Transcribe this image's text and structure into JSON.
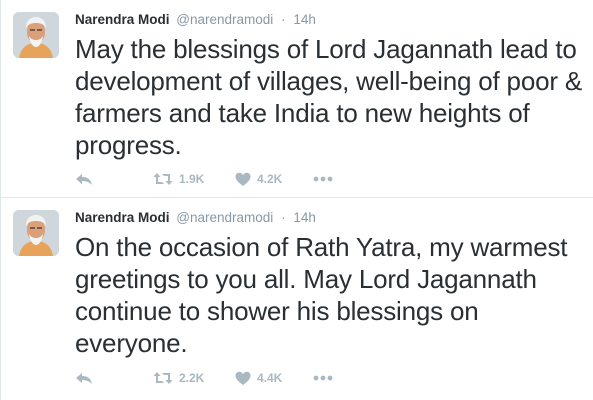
{
  "tweets": [
    {
      "author_name": "Narendra Modi",
      "author_handle": "@narendramodi",
      "separator": "·",
      "time": "14h",
      "text": "May the blessings of Lord Jagannath lead to development of villages, well-being of poor & farmers and take India to new heights of progress.",
      "retweets": "1.9K",
      "likes": "4.2K"
    },
    {
      "author_name": "Narendra Modi",
      "author_handle": "@narendramodi",
      "separator": "·",
      "time": "14h",
      "text": "On the occasion of Rath Yatra, my warmest greetings to you all. May Lord Jagannath continue to shower his blessings on everyone.",
      "retweets": "2.2K",
      "likes": "4.4K"
    }
  ],
  "icons": {
    "reply": "reply-icon",
    "retweet": "retweet-icon",
    "like": "heart-icon",
    "more": "more-icon"
  },
  "colors": {
    "text": "#292f33",
    "muted": "#8899a6",
    "action": "#aab8c2",
    "divider": "#e1e8ed"
  }
}
